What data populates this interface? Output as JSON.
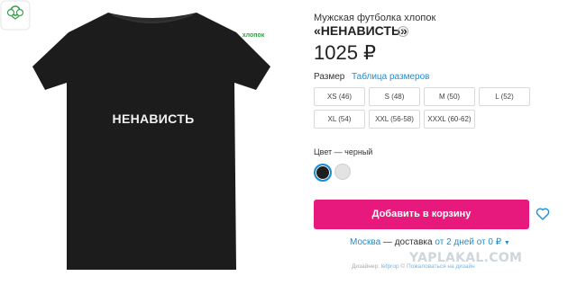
{
  "product": {
    "shirt_print": "НЕНАВИСТЬ",
    "badge": "хлопок",
    "subtitle": "Мужская футболка хлопок",
    "title": "«НЕНАВИСТЬ»",
    "info_icon": "i",
    "price": "1025 ₽"
  },
  "sizes": {
    "label": "Размер",
    "table_link": "Таблица размеров",
    "options": [
      "XS (46)",
      "S (48)",
      "M (50)",
      "L (52)",
      "XL (54)",
      "XXL (56-58)",
      "XXXL (60-62)"
    ]
  },
  "color": {
    "label": "Цвет — черный",
    "swatches": [
      "#1e1e1e",
      "#e3e3e3"
    ],
    "selected": "black"
  },
  "cart": {
    "button_label": "Добавить в корзину"
  },
  "delivery": {
    "city": "Москва",
    "text": " — доставка ",
    "days": "от 2 дней от 0 ₽",
    "chevron": "▼"
  },
  "designer": {
    "prefix": "Дизайнер: ",
    "name": "lefprop",
    "separator": " © ",
    "complaint": "Пожаловаться на дизайн"
  },
  "watermark": "YAPLAKAL.COM",
  "colors": {
    "accent": "#e8197d",
    "link": "#1a8fd6"
  }
}
